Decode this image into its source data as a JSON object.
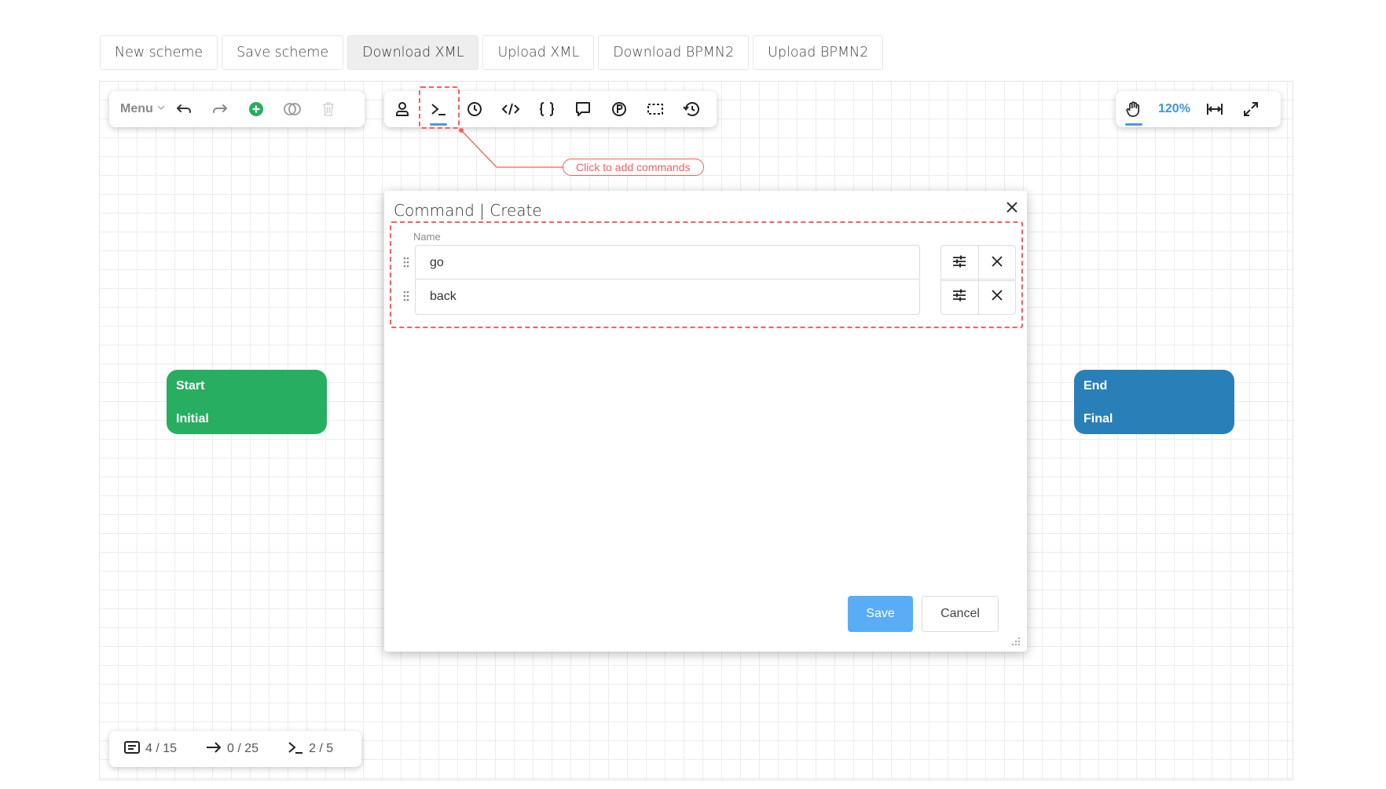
{
  "top_buttons": [
    {
      "label": "New scheme"
    },
    {
      "label": "Save scheme"
    },
    {
      "label": "Download XML"
    },
    {
      "label": "Upload XML"
    },
    {
      "label": "Download BPMN2"
    },
    {
      "label": "Upload BPMN2"
    }
  ],
  "toolbar_left": {
    "menu_label": "Menu"
  },
  "toolbar_right": {
    "zoom": "120%"
  },
  "hint": {
    "text": "Click to add commands"
  },
  "nodes": {
    "start": {
      "title": "Start",
      "state": "Initial",
      "color": "#27ae60"
    },
    "end": {
      "title": "End",
      "state": "Final",
      "color": "#2980b9"
    }
  },
  "dialog": {
    "title": "Command | Create",
    "name_label": "Name",
    "rows": [
      {
        "value": "go"
      },
      {
        "value": "back"
      }
    ],
    "save_label": "Save",
    "cancel_label": "Cancel"
  },
  "status": {
    "activities": "4 / 15",
    "transitions": "0 / 25",
    "commands": "2 / 5"
  },
  "colors": {
    "accent": "#4e97e6",
    "hint": "#ff5c5c",
    "add": "#27ae60"
  }
}
